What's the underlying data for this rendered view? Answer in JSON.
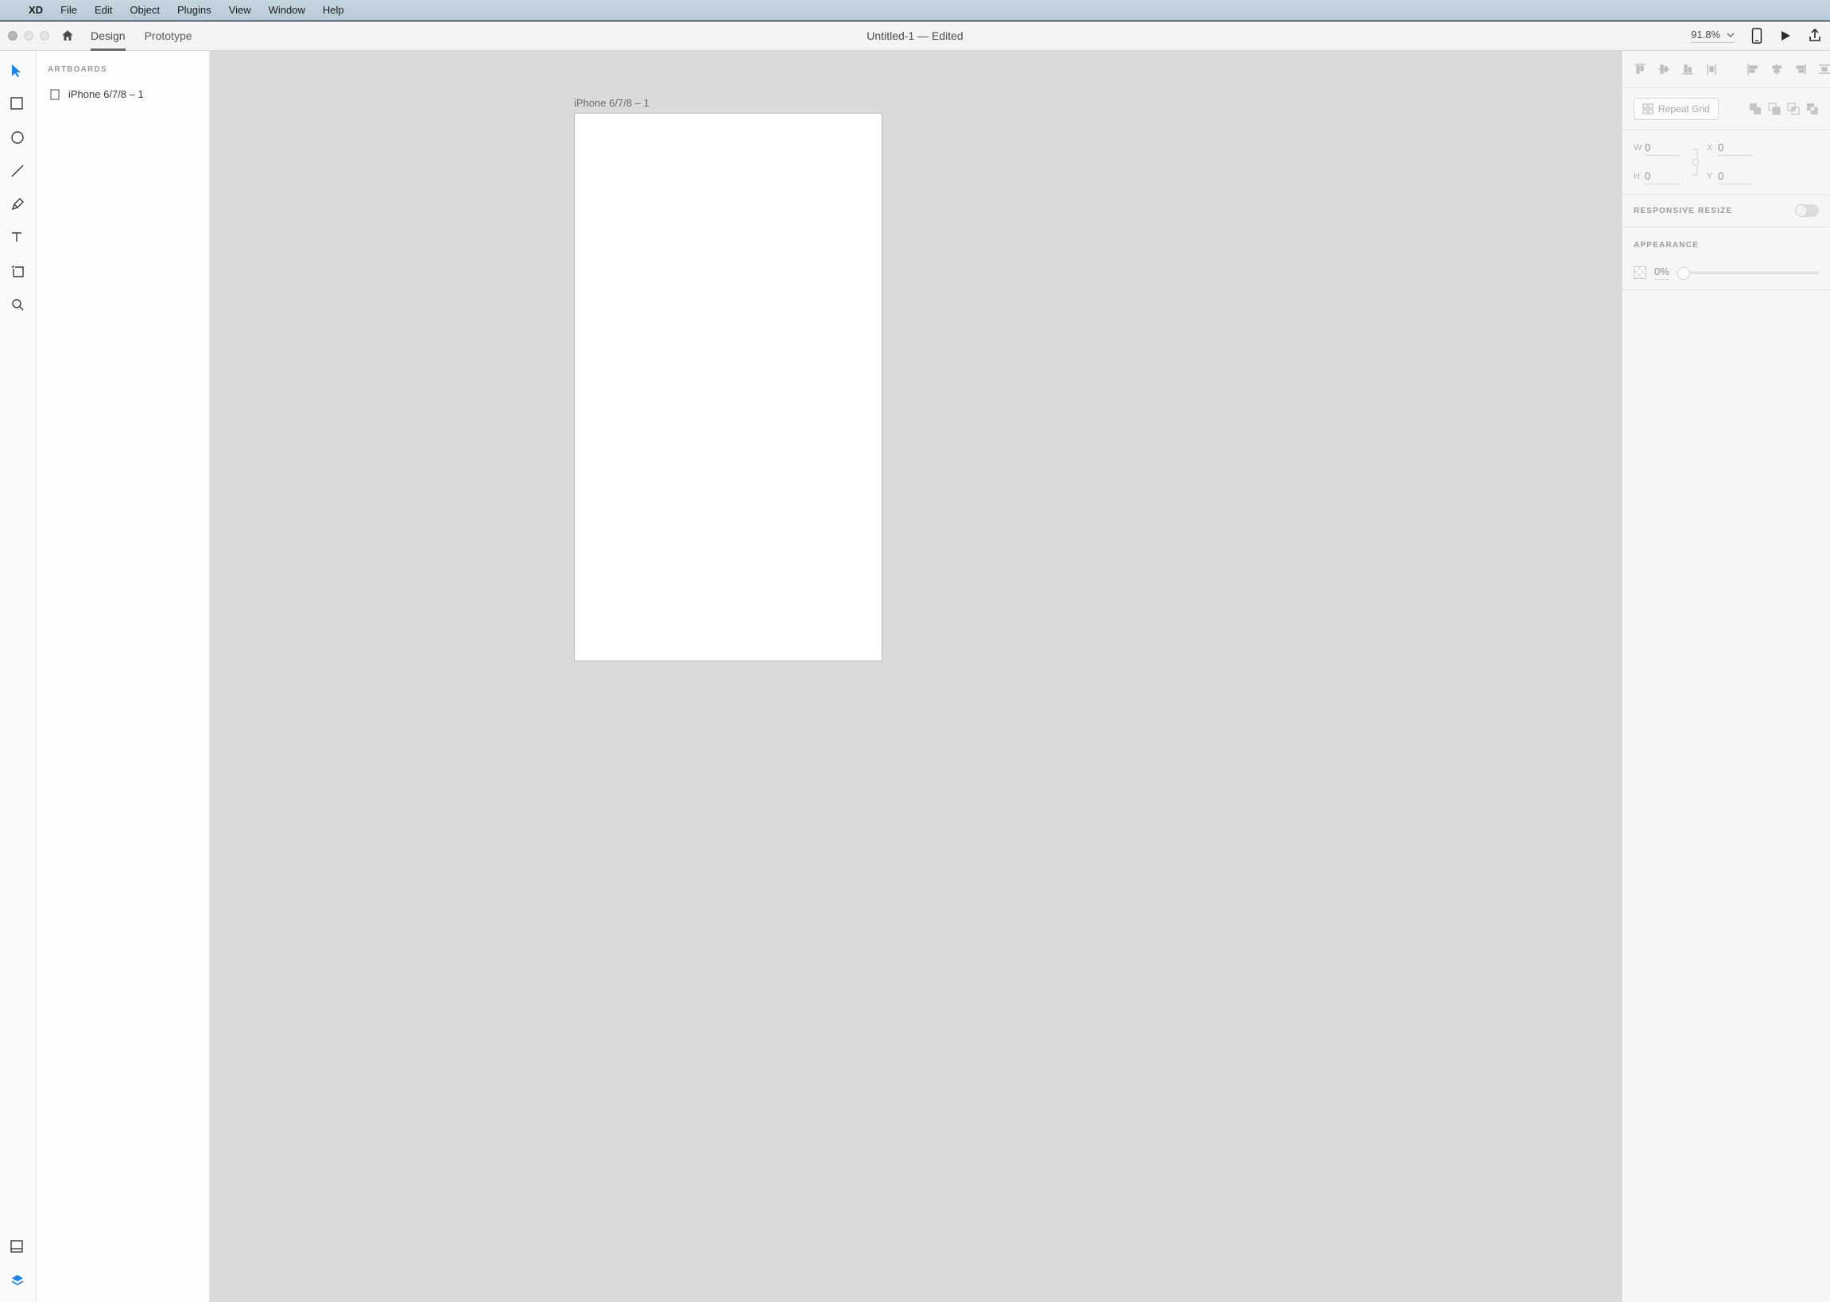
{
  "menubar": {
    "items": [
      "XD",
      "File",
      "Edit",
      "Object",
      "Plugins",
      "View",
      "Window",
      "Help"
    ]
  },
  "toolbar": {
    "modes": {
      "design": "Design",
      "prototype": "Prototype"
    },
    "title": "Untitled-1  —  Edited",
    "zoom": "91.8%"
  },
  "layers": {
    "heading": "ARTBOARDS",
    "items": [
      {
        "name": "iPhone 6/7/8 – 1"
      }
    ]
  },
  "canvas": {
    "artboard_label": "iPhone 6/7/8 – 1"
  },
  "inspector": {
    "repeat_grid": "Repeat Grid",
    "dims": {
      "w_label": "W",
      "h_label": "H",
      "x_label": "X",
      "y_label": "Y",
      "w": "0",
      "h": "0",
      "x": "0",
      "y": "0"
    },
    "responsive": "RESPONSIVE RESIZE",
    "appearance": "APPEARANCE",
    "opacity": "0%"
  }
}
